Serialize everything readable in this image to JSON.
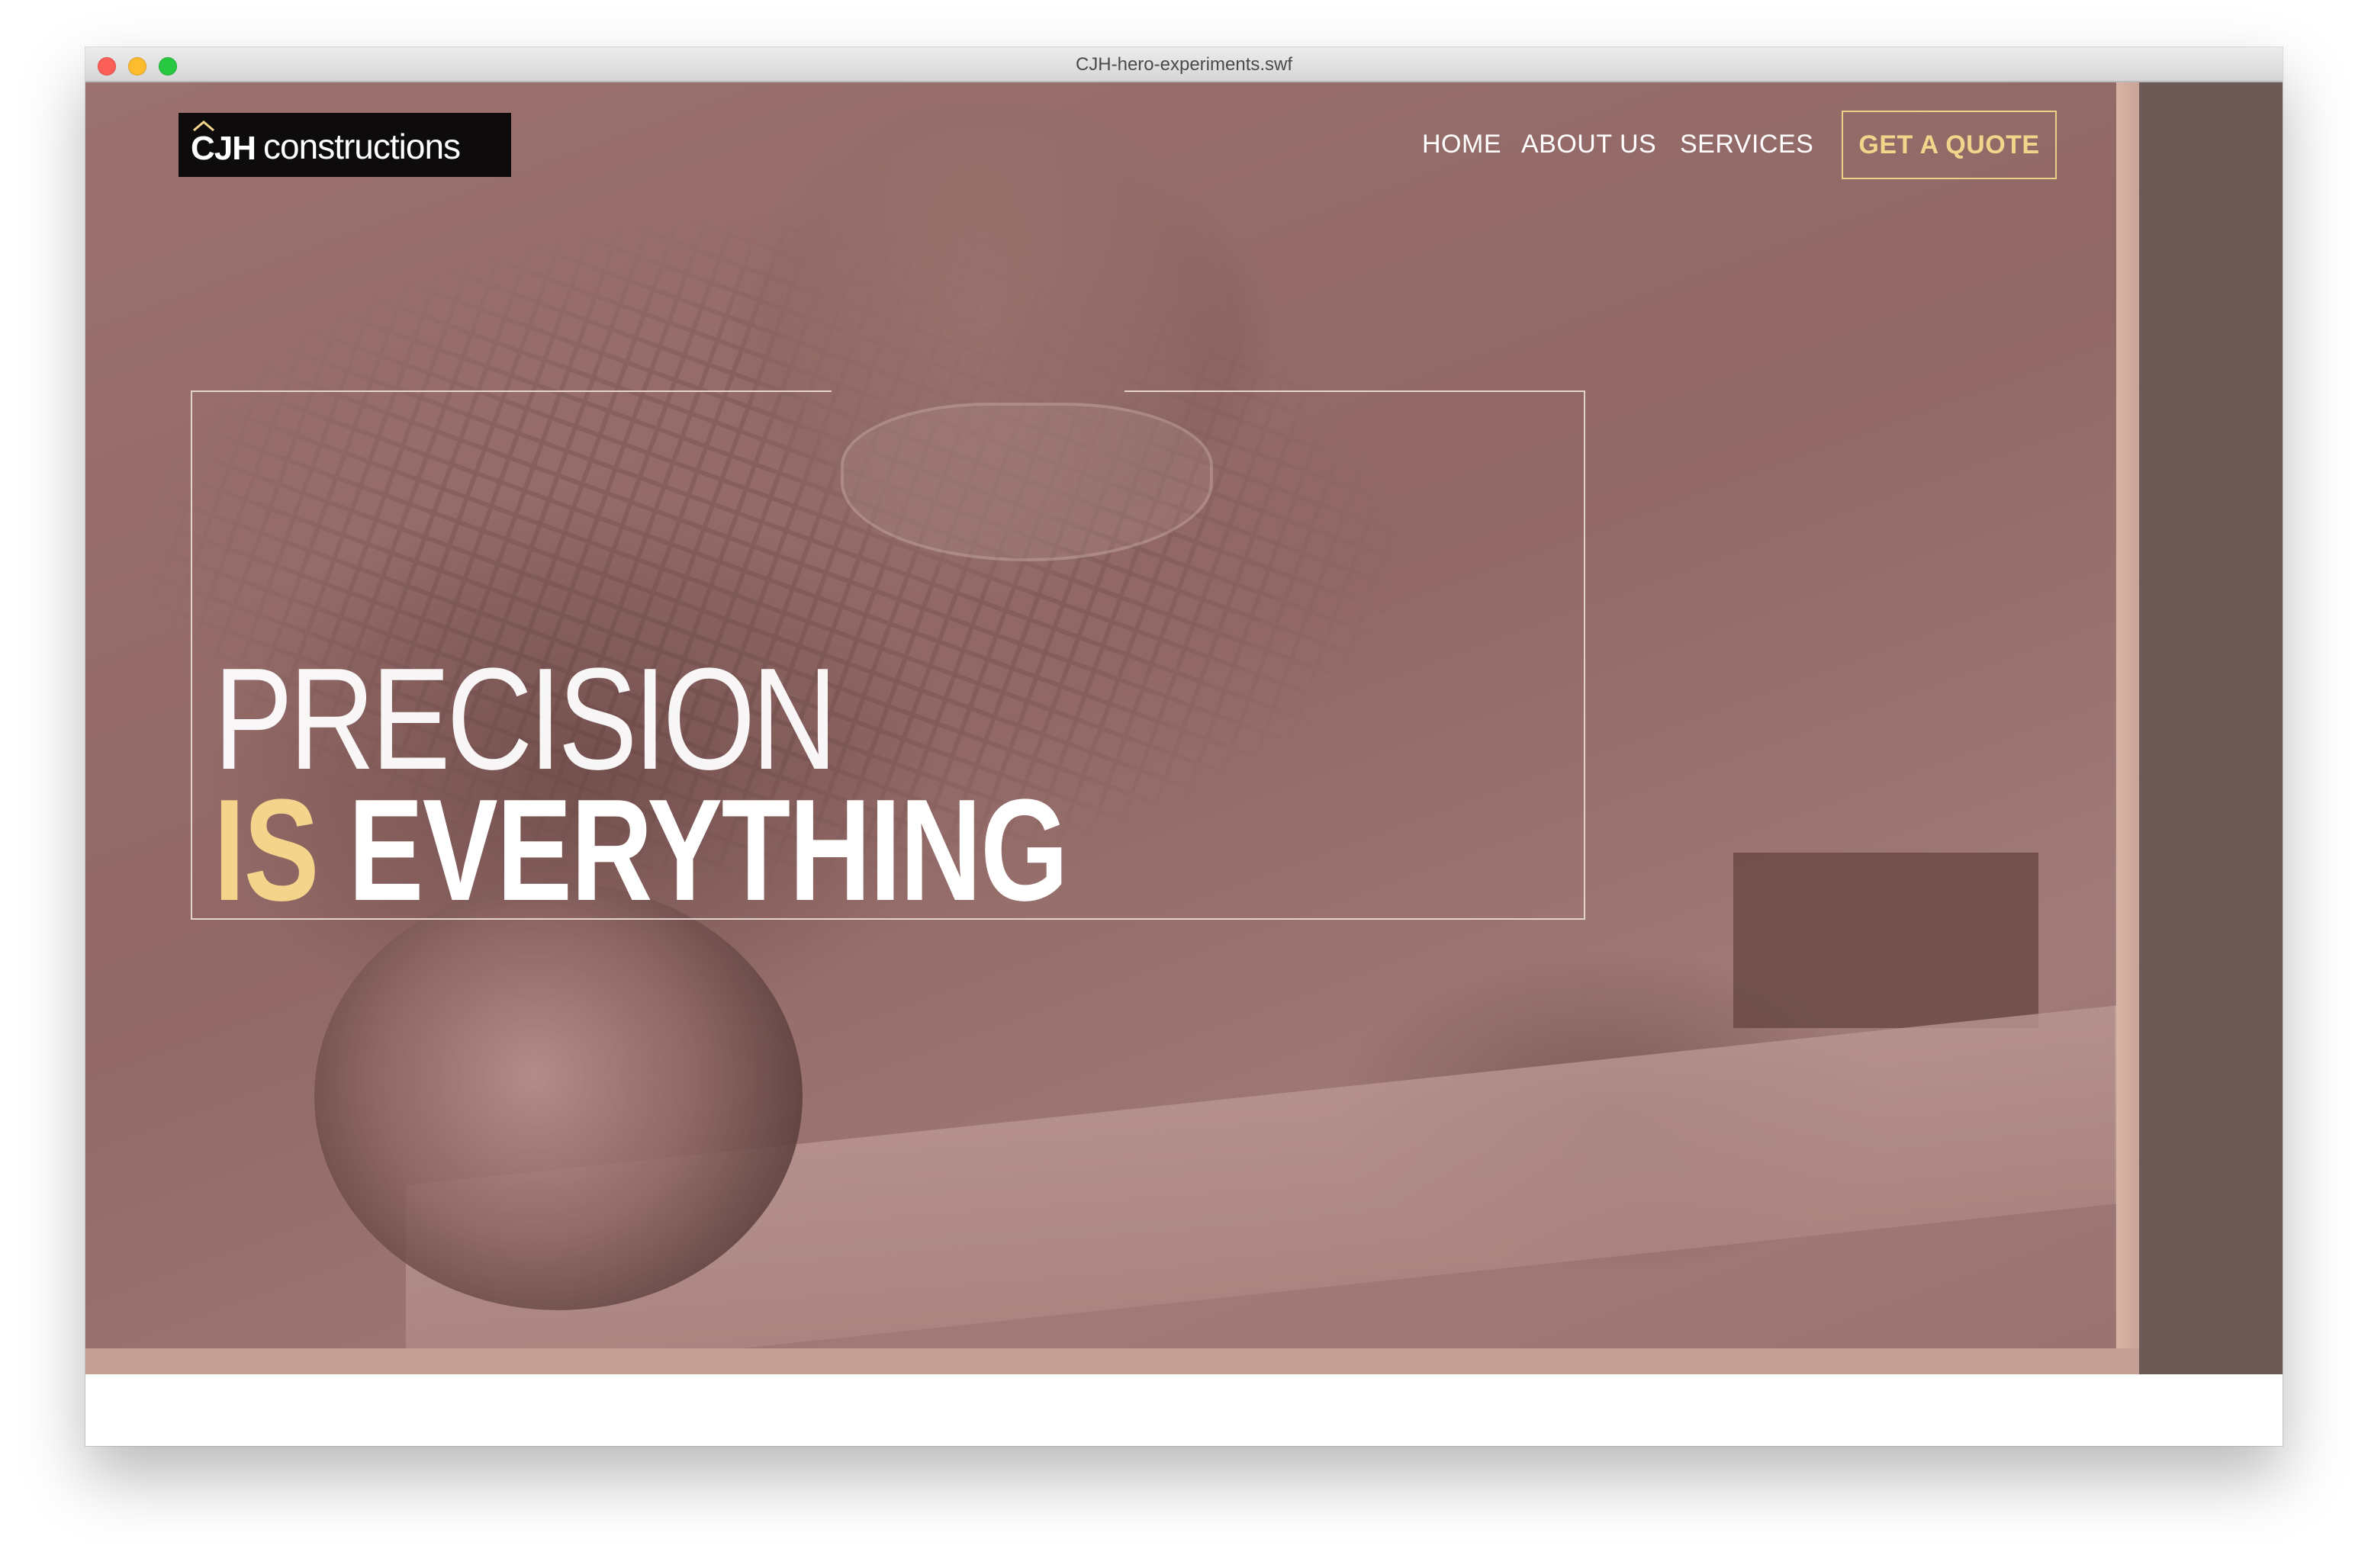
{
  "window": {
    "title": "CJH-hero-experiments.swf"
  },
  "brand": {
    "logo_bold": "CJH",
    "logo_light": "constructions",
    "accent_color": "#f3d48a"
  },
  "nav": {
    "items": [
      {
        "label": "HOME"
      },
      {
        "label": "ABOUT US"
      },
      {
        "label": "SERVICES"
      }
    ],
    "cta_label": "GET A QUOTE"
  },
  "hero": {
    "line1": "PRECISION",
    "line2_accent": "IS",
    "line2_rest": "EVERYTHING",
    "overlay_color": "#8f6a68"
  }
}
